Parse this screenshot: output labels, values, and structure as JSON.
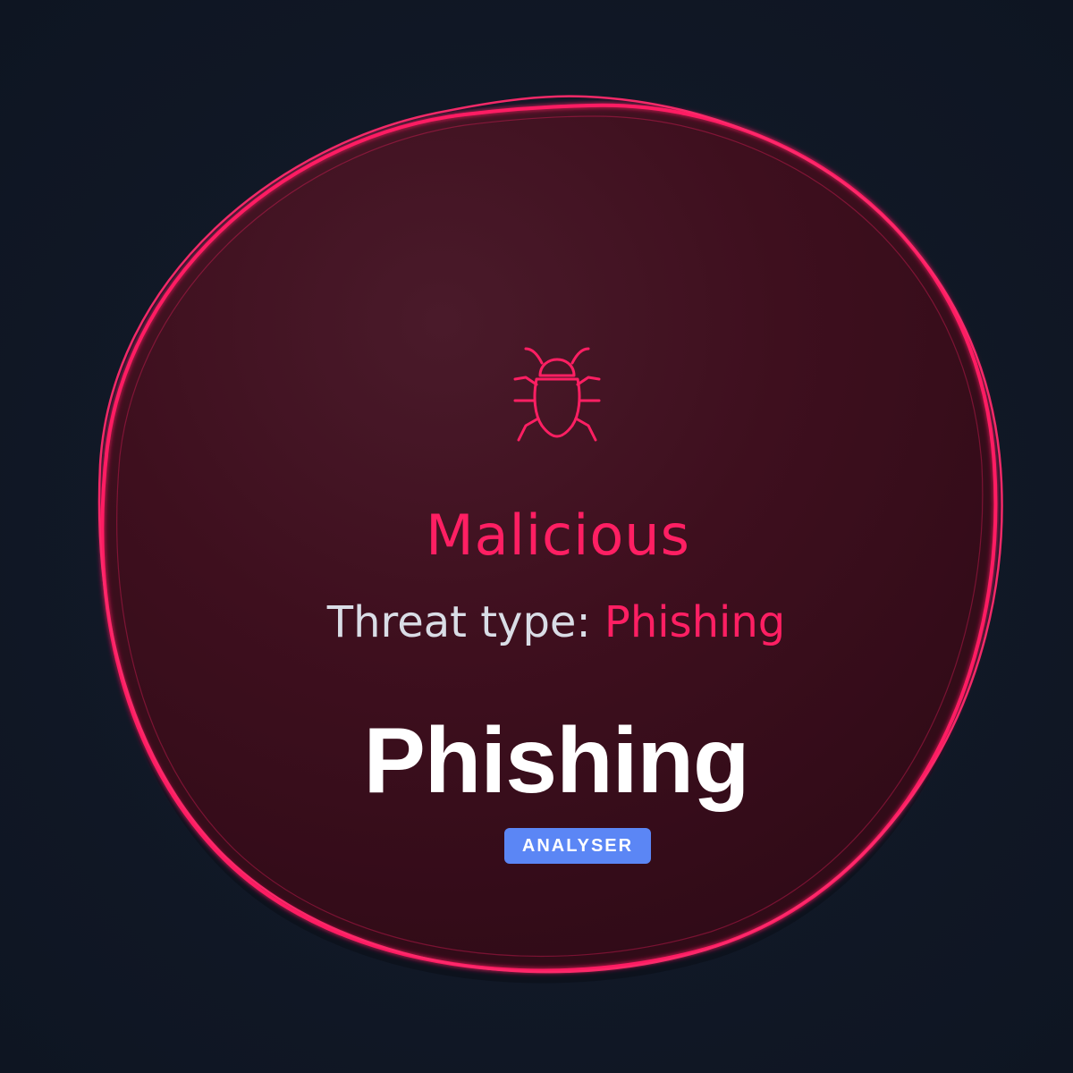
{
  "result": {
    "icon": "bug-icon",
    "verdict": "Malicious",
    "threat_label": "Threat type: ",
    "threat_value": "Phishing"
  },
  "brand": {
    "title": "Phishing",
    "badge": "ANALYSER"
  },
  "colors": {
    "background": "#111826",
    "accent": "#ff1f63",
    "blob_fill": "#3d0f1d",
    "label_text": "#d9dde6",
    "badge": "#5b86f5",
    "title_text": "#ffffff"
  }
}
